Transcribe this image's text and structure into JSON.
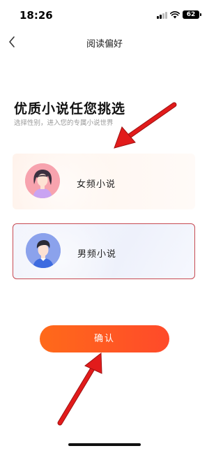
{
  "status_bar": {
    "time": "18:26",
    "battery": "62",
    "icons": [
      "signal-icon",
      "wifi-icon",
      "battery-icon"
    ]
  },
  "header": {
    "back_icon": "chevron-left-icon",
    "title": "阅读偏好"
  },
  "intro": {
    "headline": "优质小说任您挑选",
    "subtitle": "选择性别，进入您的专属小说世界"
  },
  "options": [
    {
      "label": "女频小说",
      "avatar_icon": "female-avatar-icon",
      "selected": false
    },
    {
      "label": "男频小说",
      "avatar_icon": "male-avatar-icon",
      "selected": true
    }
  ],
  "confirm_label": "确认",
  "colors": {
    "accent": "#ff5a22",
    "selected_border": "#c74a52",
    "annotation_arrow": "#e21b1b"
  }
}
